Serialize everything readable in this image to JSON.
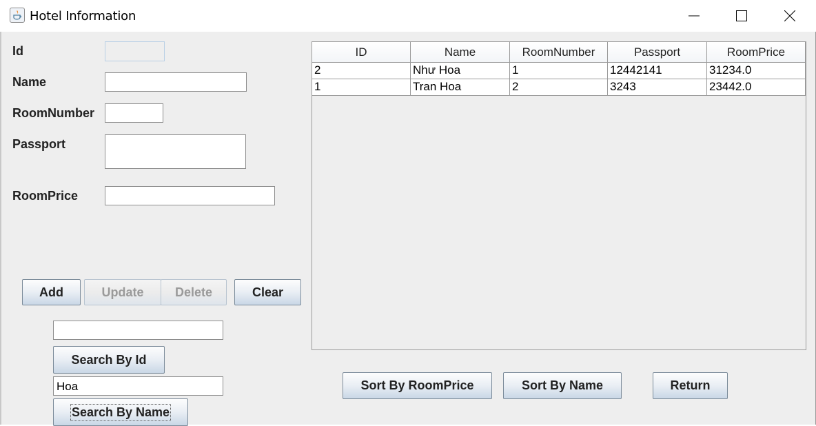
{
  "window": {
    "title": "Hotel Information"
  },
  "form": {
    "id_label": "Id",
    "name_label": "Name",
    "room_number_label": "RoomNumber",
    "passport_label": "Passport",
    "room_price_label": "RoomPrice",
    "id_value": "",
    "name_value": "",
    "room_number_value": "",
    "passport_value": "",
    "room_price_value": ""
  },
  "actions": {
    "add": "Add",
    "update": "Update",
    "delete": "Delete",
    "clear": "Clear"
  },
  "search": {
    "id_value": "",
    "id_button": "Search By Id",
    "name_value": "Hoa",
    "name_button": "Search By Name"
  },
  "table": {
    "columns": [
      "ID",
      "Name",
      "RoomNumber",
      "Passport",
      "RoomPrice"
    ],
    "rows": [
      [
        "2",
        "Như Hoa",
        "1",
        "12442141",
        "31234.0"
      ],
      [
        "1",
        "Tran Hoa",
        "2",
        "3243",
        "23442.0"
      ]
    ]
  },
  "sort": {
    "by_room_price": "Sort By RoomPrice",
    "by_name": "Sort By Name",
    "return": "Return"
  }
}
